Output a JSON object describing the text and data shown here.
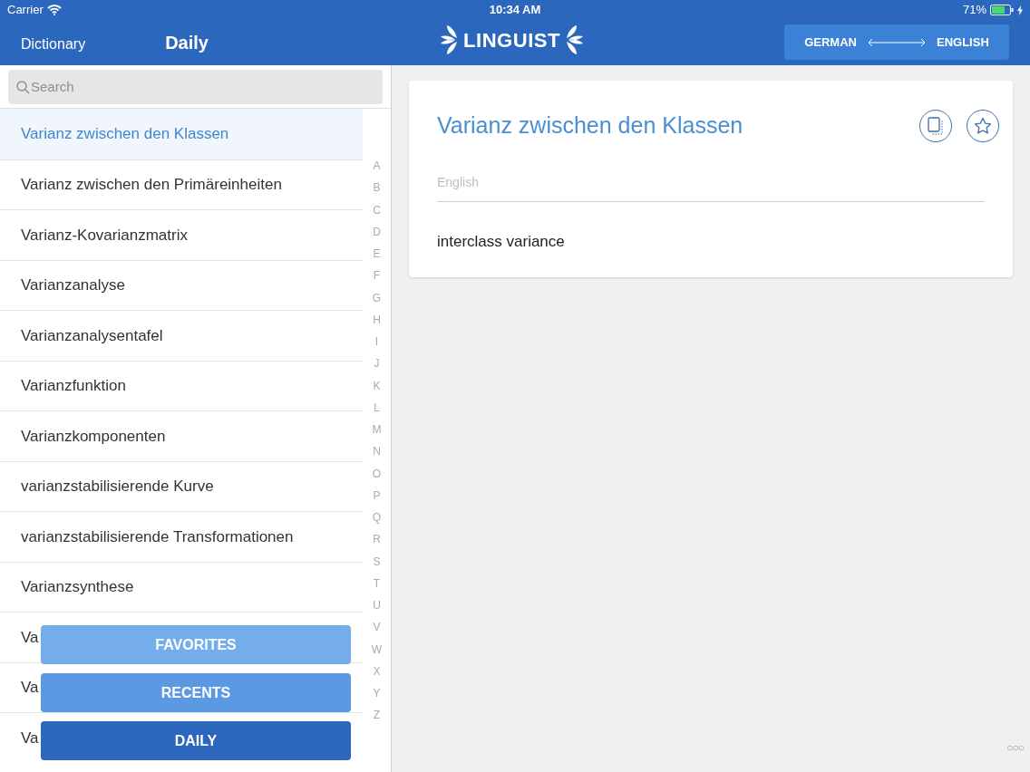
{
  "status_bar": {
    "carrier": "Carrier",
    "time": "10:34 AM",
    "battery": "71%"
  },
  "nav": {
    "back": "Dictionary",
    "title": "Daily",
    "logo": "LINGUIST",
    "source_language": "GERMAN",
    "target_language": "ENGLISH"
  },
  "search": {
    "placeholder": "Search"
  },
  "entries": [
    {
      "text": "Varianz zwischen den Klassen",
      "selected": true
    },
    {
      "text": "Varianz zwischen den Primäreinheiten",
      "selected": false
    },
    {
      "text": "Varianz-Kovarianzmatrix",
      "selected": false
    },
    {
      "text": "Varianzanalyse",
      "selected": false
    },
    {
      "text": "Varianzanalysentafel",
      "selected": false
    },
    {
      "text": "Varianzfunktion",
      "selected": false
    },
    {
      "text": "Varianzkomponenten",
      "selected": false
    },
    {
      "text": "varianzstabilisierende Kurve",
      "selected": false
    },
    {
      "text": "varianzstabilisierende Transformationen",
      "selected": false
    },
    {
      "text": "Varianzsynthese",
      "selected": false
    },
    {
      "text": "Va",
      "selected": false
    },
    {
      "text": "Va",
      "selected": false
    },
    {
      "text": "Va",
      "selected": false
    }
  ],
  "index_letters": [
    "A",
    "B",
    "C",
    "D",
    "E",
    "F",
    "G",
    "H",
    "I",
    "J",
    "K",
    "L",
    "M",
    "N",
    "O",
    "P",
    "Q",
    "R",
    "S",
    "T",
    "U",
    "V",
    "W",
    "X",
    "Y",
    "Z"
  ],
  "tabs": [
    {
      "label": "FAVORITES",
      "selected": false
    },
    {
      "label": "RECENTS",
      "selected": false
    },
    {
      "label": "DAILY",
      "selected": true
    }
  ],
  "detail": {
    "term": "Varianz zwischen den Klassen",
    "language_label": "English",
    "translation": "interclass variance"
  },
  "more": "○○○"
}
